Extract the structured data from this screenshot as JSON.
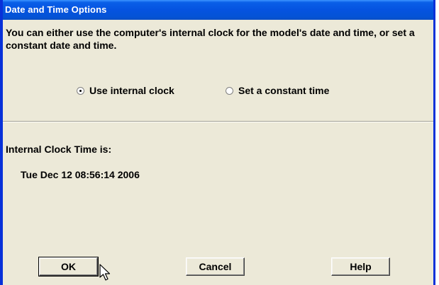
{
  "window": {
    "title": "Date and Time Options",
    "frame_color": "#0831d9",
    "background": "#ece9d8"
  },
  "description": "You can either use the computer's internal clock for the model's date and time, or set a constant date and time.",
  "options": [
    {
      "label": "Use internal clock",
      "selected": true
    },
    {
      "label": "Set a constant time",
      "selected": false
    }
  ],
  "clock": {
    "label": "Internal Clock Time is:",
    "value": "Tue Dec 12 08:56:14 2006"
  },
  "buttons": {
    "ok": "OK",
    "cancel": "Cancel",
    "help": "Help"
  },
  "cursor": "arrow-pointer-icon"
}
